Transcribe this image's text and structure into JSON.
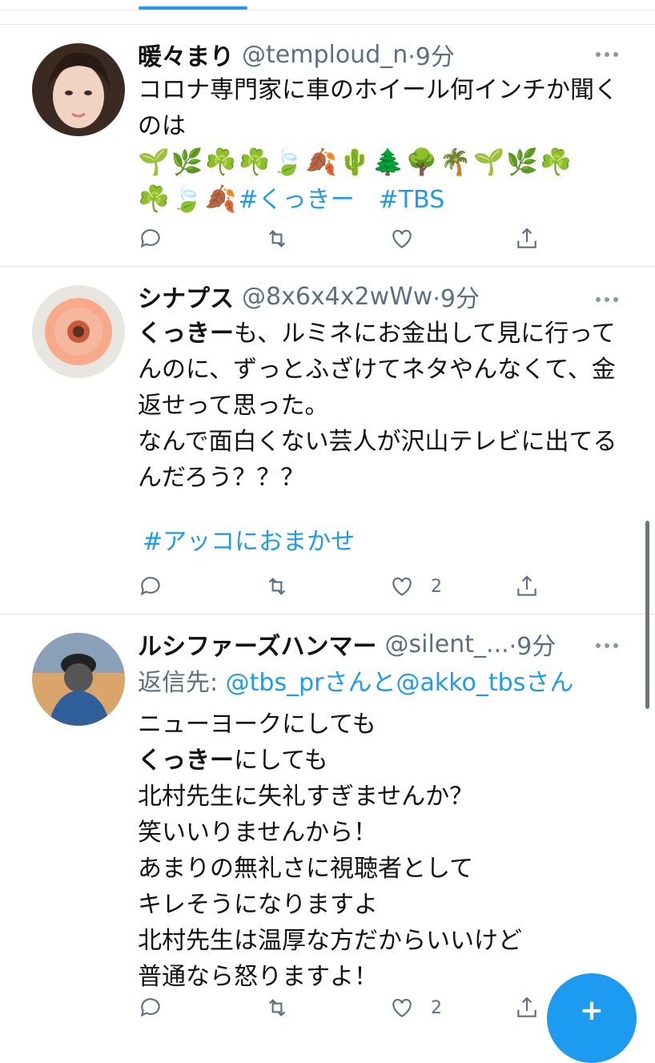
{
  "tweets": [
    {
      "name": "暖々まり",
      "handle": "@temploud_n",
      "time": "·9分",
      "text": "コロナ専門家に車のホイール何インチか聞くのは",
      "emojis": "🌱🌿☘️☘️🍃🍂🌵🌲🌳🌴🌱🌿☘️",
      "emojis2": "☘️🍃🍂",
      "hashtags": [
        "#くっきー",
        "#TBS"
      ],
      "like_count": ""
    },
    {
      "name": "シナプス",
      "handle": "@8x6x4x2wWw",
      "time": "·9分",
      "bold": "くっきー",
      "text": "も、ルミネにお金出して見に行ってんのに、ずっとふざけてネタやんなくて、金返せって思った。\nなんで面白くない芸人が沢山テレビに出てるんだろう？？？",
      "hashtags": [
        "#アッコにおまかせ"
      ],
      "like_count": "2"
    },
    {
      "name": "ルシファーズハンマー",
      "handle": "@silent_...",
      "time": "·9分",
      "reply_prefix": "返信先: ",
      "reply_to": "@tbs_prさんと@akko_tbsさん",
      "line1": "ニューヨークにしても",
      "bold": "くっきー",
      "line2": "にしても",
      "text": "北村先生に失礼すぎませんか？\n笑いいりませんから！\nあまりの無礼さに視聴者として\nキレそうになりますよ\n北村先生は温厚な方だからいいけど\n普通なら怒りますよ！",
      "like_count": "2"
    }
  ],
  "fab": {
    "icon": "compose-icon",
    "symbol": "+"
  },
  "colors": {
    "accent": "#1d9bf0",
    "muted": "#5b7083"
  }
}
